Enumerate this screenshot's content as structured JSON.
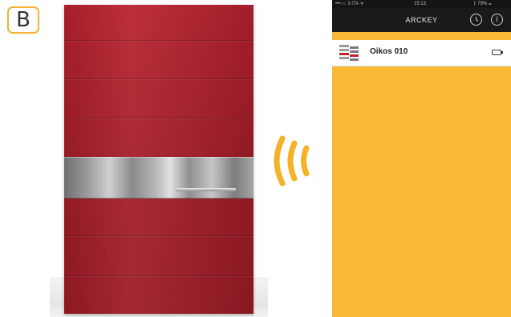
{
  "badge": {
    "label": "B"
  },
  "phone": {
    "status": {
      "carrier": "•••○○ 3 ITA ᯤ",
      "time": "15:13",
      "battery": "ᛒ 79% ▭"
    },
    "nav": {
      "title": "ARCKEY",
      "history_icon": "clock-icon",
      "info_icon": "info-icon",
      "info_glyph": "i"
    },
    "list": [
      {
        "label": "Oikos 010",
        "icon": "door-logo-icon",
        "status_icon": "battery-icon"
      }
    ]
  },
  "colors": {
    "door_red": "#a81f2b",
    "accent_orange": "#f9b835",
    "signal_orange": "#f5b227"
  }
}
